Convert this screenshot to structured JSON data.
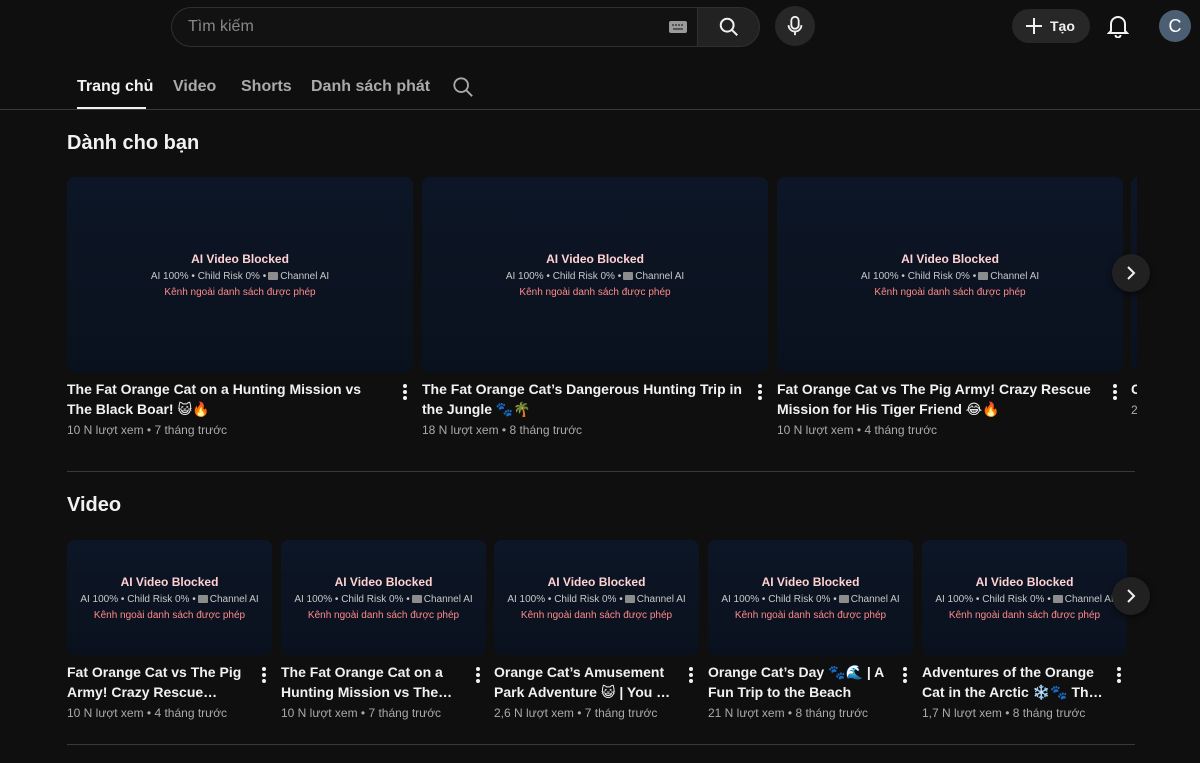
{
  "header": {
    "search_placeholder": "Tìm kiếm",
    "create_label": "Tạo",
    "avatar_letter": "C"
  },
  "tabs": [
    {
      "label": "Trang chủ",
      "active": true
    },
    {
      "label": "Video",
      "active": false
    },
    {
      "label": "Shorts",
      "active": false
    },
    {
      "label": "Danh sách phát",
      "active": false
    }
  ],
  "blocked_overlay": {
    "title": "AI Video Blocked",
    "info_a": "AI 100% • Child Risk 0% •",
    "info_b": "Channel AI",
    "notice": "Kênh ngoài danh sách được phép"
  },
  "for_you": {
    "title": "Dành cho bạn",
    "videos": [
      {
        "title": " The Fat Orange Cat on a Hunting Mission vs The Black Boar! 😺🔥",
        "meta": "10 N lượt xem • 7 tháng trước"
      },
      {
        "title": "The Fat Orange Cat’s Dangerous Hunting Trip in the Jungle 🐾🌴",
        "meta": "18 N lượt xem • 8 tháng trước"
      },
      {
        "title": "Fat Orange Cat vs The Pig Army! Crazy Rescue Mission for His Tiger Friend 😂🔥",
        "meta": "10 N lượt xem • 4 tháng trước"
      }
    ],
    "peek_title": "C",
    "peek_meta": "2"
  },
  "video_section": {
    "title": "Video",
    "videos": [
      {
        "title": "Fat Orange Cat vs The Pig Army! Crazy Rescue Missio…",
        "meta": "10 N lượt xem • 4 tháng trước"
      },
      {
        "title": "The Fat Orange Cat on a Hunting Mission vs The Bla…",
        "meta": "10 N lượt xem • 7 tháng trước"
      },
      {
        "title": "Orange Cat’s Amusement Park Adventure 😺 | You …",
        "meta": "2,6 N lượt xem • 7 tháng trước"
      },
      {
        "title": "Orange Cat’s Day 🐾🌊 | A Fun Trip to the Beach",
        "meta": "21 N lượt xem • 8 tháng trước"
      },
      {
        "title": "Adventures of the Orange Cat in the Arctic ❄️🐾 The Sudd…",
        "meta": "1,7 N lượt xem • 8 tháng trước"
      }
    ]
  },
  "colors": {
    "background": "#0f0f0f",
    "thumb": "#0d1524",
    "blocked_title": "#ffd2d2",
    "notice": "#ff8a8a"
  }
}
